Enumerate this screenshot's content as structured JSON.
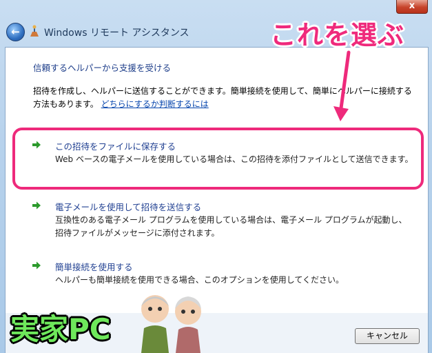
{
  "window": {
    "title": "Windows リモート アシスタンス",
    "close_label": "x"
  },
  "content": {
    "heading": "信頼するヘルパーから支援を受ける",
    "description": "招待を作成し、ヘルパーに送信することができます。簡単接続を使用して、簡単にヘルパーに接続する方法もあります。",
    "help_link": "どちらにするか判断するには",
    "options": [
      {
        "title": "この招待をファイルに保存する",
        "text": "Web ベースの電子メールを使用している場合は、この招待を添付ファイルとして送信できます。"
      },
      {
        "title": "電子メールを使用して招待を送信する",
        "text": "互換性のある電子メール プログラムを使用している場合は、電子メール プログラムが起動し、招待ファイルがメッセージに添付されます。"
      },
      {
        "title": "簡単接続を使用する",
        "text": "ヘルパーも簡単接続を使用できる場合、このオプションを使用してください。"
      }
    ]
  },
  "footer": {
    "cancel_label": "キャンセル"
  },
  "annotation": {
    "callout": "これを選ぶ",
    "label": "実家PC",
    "accent_color": "#ee2a7b",
    "label_color": "#6ee85b"
  }
}
